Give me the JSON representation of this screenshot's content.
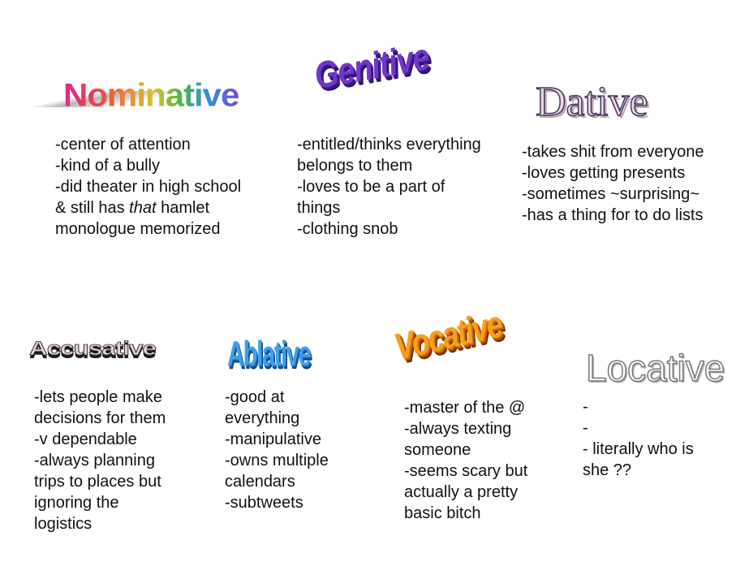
{
  "cases": {
    "nominative": {
      "title": "Nominative",
      "lines": [
        "-center of attention",
        "-kind of a bully",
        "-did theater in high school",
        "& still has ",
        "monologue memorized"
      ],
      "emph": "that",
      "after_emph": " hamlet"
    },
    "genitive": {
      "title": "Genitive",
      "lines": [
        "-entitled/thinks everything",
        "belongs to them",
        "-loves to be a part of",
        "things",
        "-clothing snob"
      ]
    },
    "dative": {
      "title": "Dative",
      "lines": [
        "-takes shit from everyone",
        "-loves getting presents",
        "-sometimes ~surprising~",
        "-has a thing for to do lists"
      ]
    },
    "accusative": {
      "title": "Accusative",
      "lines": [
        "-lets people make",
        "decisions for them",
        "-v dependable",
        "-always planning",
        "trips to places but",
        "ignoring the",
        "logistics"
      ]
    },
    "ablative": {
      "title": "Ablative",
      "lines": [
        "-good at",
        "everything",
        "-manipulative",
        "-owns multiple",
        "calendars",
        "-subtweets"
      ]
    },
    "vocative": {
      "title": "Vocative",
      "lines": [
        "-master of the @",
        "-always texting",
        "someone",
        "-seems scary but",
        "actually a pretty",
        "basic bitch"
      ]
    },
    "locative": {
      "title": "Locative",
      "lines": [
        "-",
        "-",
        "- literally who is",
        "she ??"
      ]
    }
  }
}
